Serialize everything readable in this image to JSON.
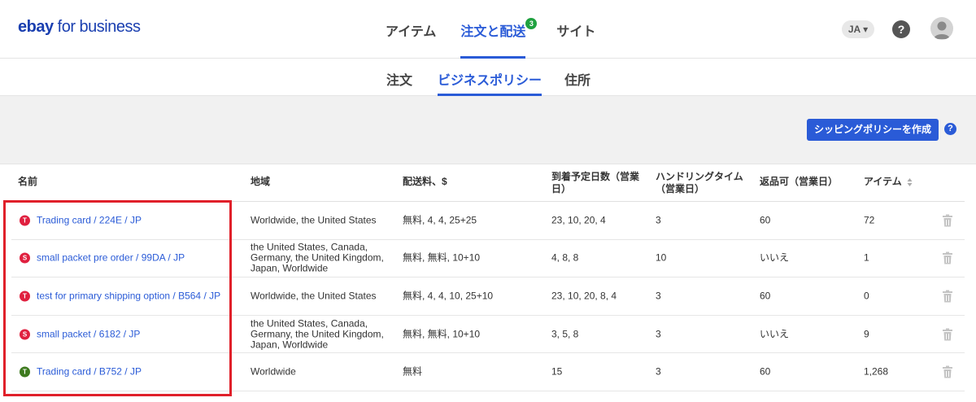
{
  "header": {
    "logo_bold": "ebay",
    "logo_regular": " for business",
    "nav": [
      {
        "label": "アイテム",
        "active": false
      },
      {
        "label": "注文と配送",
        "active": true,
        "badge": "3"
      },
      {
        "label": "サイト",
        "active": false
      }
    ],
    "language": "JA ▾",
    "help_glyph": "?"
  },
  "subnav": {
    "items": [
      {
        "label": "注文",
        "active": false
      },
      {
        "label": "ビジネスポリシー",
        "active": true
      },
      {
        "label": "住所",
        "active": false
      }
    ]
  },
  "actions": {
    "create_label": "シッピングポリシーを作成",
    "help_glyph": "?"
  },
  "table": {
    "headers": {
      "name": "名前",
      "region": "地域",
      "cost": "配送料、$",
      "est": "到着予定日数（営業日）",
      "handling": "ハンドリングタイム（営業日）",
      "returns": "返品可（営業日）",
      "items": "アイテム"
    },
    "rows": [
      {
        "type": "T",
        "type_color": "#e0203f",
        "name": "Trading card / 224E / JP",
        "region": "Worldwide, the United States",
        "cost": "無料, 4, 4, 25+25",
        "est": "23, 10, 20, 4",
        "handling": "3",
        "returns": "60",
        "items": "72"
      },
      {
        "type": "S",
        "type_color": "#e0203f",
        "name": "small packet pre order / 99DA / JP",
        "region": "the United States, Canada, Germany, the United Kingdom, Japan, Worldwide",
        "cost": "無料, 無料, 10+10",
        "est": "4, 8, 8",
        "handling": "10",
        "returns": "いいえ",
        "items": "1"
      },
      {
        "type": "T",
        "type_color": "#e0203f",
        "name": "test for primary shipping option / B564 / JP",
        "region": "Worldwide, the United States",
        "cost": "無料, 4, 4, 10, 25+10",
        "est": "23, 10, 20, 8, 4",
        "handling": "3",
        "returns": "60",
        "items": "0"
      },
      {
        "type": "S",
        "type_color": "#e0203f",
        "name": "small packet / 6182 / JP",
        "region": "the United States, Canada, Germany, the United Kingdom, Japan, Worldwide",
        "cost": "無料, 無料, 10+10",
        "est": "3, 5, 8",
        "handling": "3",
        "returns": "いいえ",
        "items": "9"
      },
      {
        "type": "T",
        "type_color": "#3d7a1e",
        "name": "Trading card / B752 / JP",
        "region": "Worldwide",
        "cost": "無料",
        "est": "15",
        "handling": "3",
        "returns": "60",
        "items": "1,268"
      }
    ]
  },
  "colors": {
    "accent": "#2a5bd7",
    "highlight": "#e0202a",
    "badge": "#1fa13f"
  }
}
